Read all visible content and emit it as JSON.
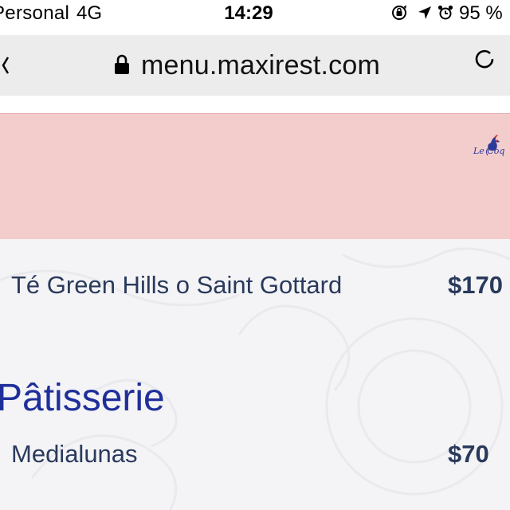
{
  "status_bar": {
    "carrier": "Personal",
    "network": "4G",
    "time": "14:29",
    "battery": "95 %",
    "icons": [
      "rotation-lock-icon",
      "location-arrow-icon",
      "alarm-icon"
    ]
  },
  "browser": {
    "url": "menu.maxirest.com",
    "icons": [
      "lock-icon",
      "reload-icon"
    ]
  },
  "banner": {
    "background": "#f3cccc",
    "logo_text": "Le Coq"
  },
  "menu": {
    "items_top": [
      {
        "name": "Té Green Hills o Saint Gottard",
        "price": "$170"
      }
    ],
    "section": {
      "title": "Pâtisserie",
      "items": [
        {
          "name": "Medialunas",
          "price": "$70"
        }
      ]
    }
  },
  "colors": {
    "item_text": "#2a3a5c",
    "section_title": "#1f2f9a",
    "page_bg": "#f4f4f6"
  }
}
